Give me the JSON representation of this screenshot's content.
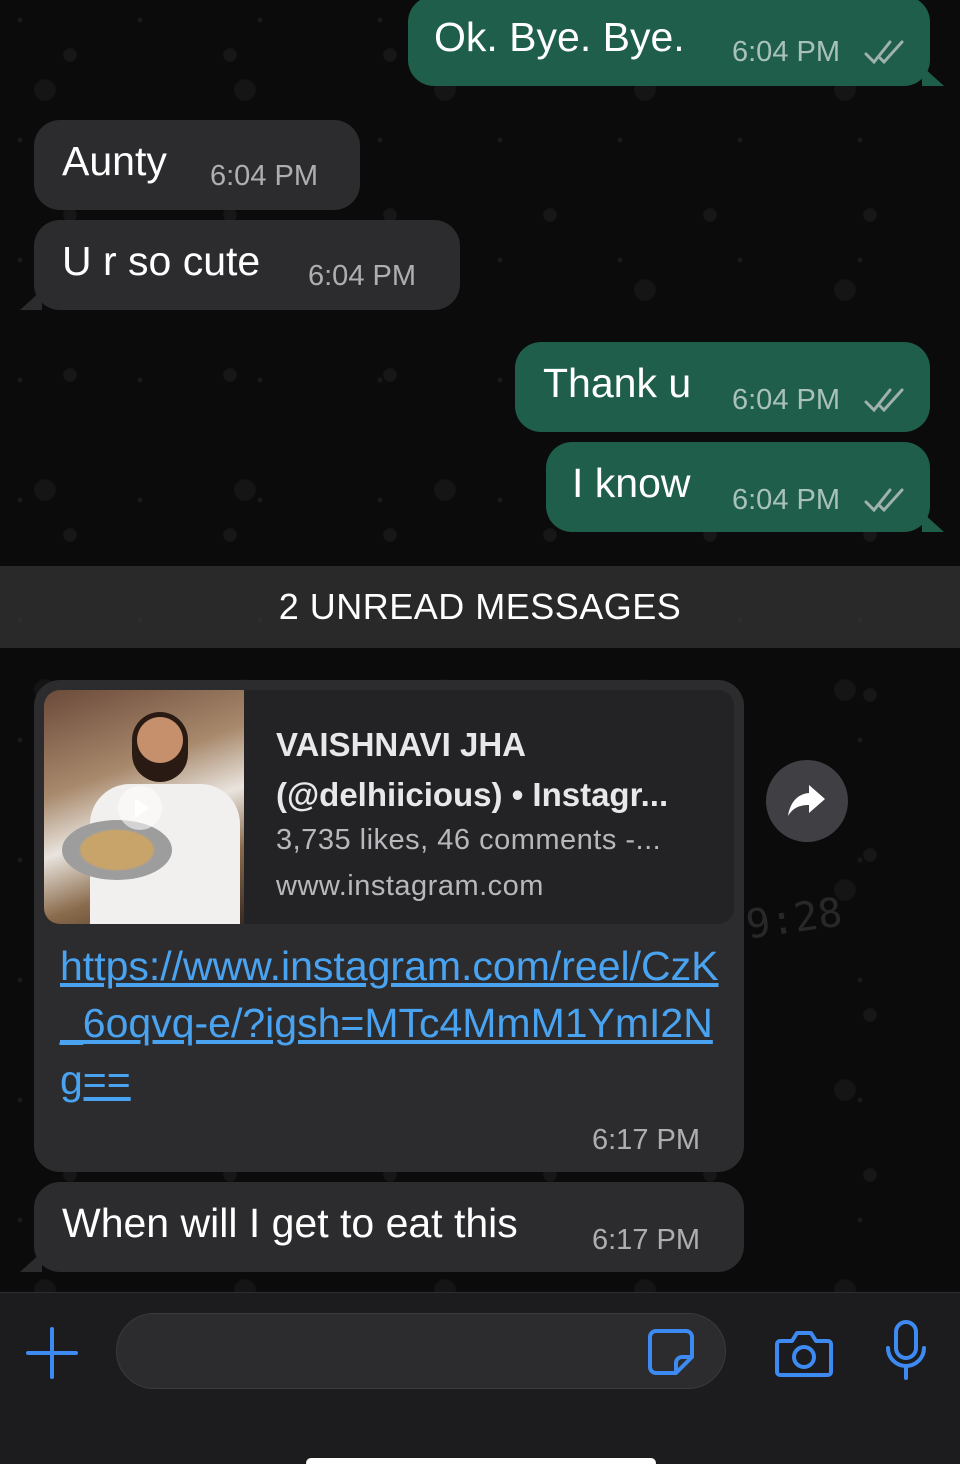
{
  "colors": {
    "outgoing_bubble": "#1e5e4a",
    "incoming_bubble": "#2c2c2e",
    "link": "#4aa3f0",
    "accent_icon": "#3d8bf2",
    "background": "#0b0b0b"
  },
  "messages": [
    {
      "id": "m1",
      "direction": "outgoing",
      "text": "Ok. Bye. Bye.",
      "time": "6:04 PM",
      "status_icon": "double-check-icon"
    },
    {
      "id": "m2",
      "direction": "incoming",
      "text": "Aunty",
      "time": "6:04 PM"
    },
    {
      "id": "m3",
      "direction": "incoming",
      "text": "U r so cute",
      "time": "6:04 PM"
    },
    {
      "id": "m4",
      "direction": "outgoing",
      "text": "Thank u",
      "time": "6:04 PM",
      "status_icon": "double-check-icon"
    },
    {
      "id": "m5",
      "direction": "outgoing",
      "text": "I know",
      "time": "6:04 PM",
      "status_icon": "double-check-icon"
    }
  ],
  "unread_divider": "2 UNREAD MESSAGES",
  "link_message": {
    "preview": {
      "title_line1": "VAISHNAVI JHA",
      "title_line2": "(@delhiicious) • Instagr...",
      "description": "3,735 likes, 46 comments -...",
      "domain": "www.instagram.com",
      "thumbnail_icon": "video-thumbnail-icon"
    },
    "url_text": "https://www.instagram.com/reel/CzK_6oqvq-e/?igsh=MTc4MmM1YmI2Ng==",
    "time": "6:17 PM"
  },
  "last_message": {
    "text": "When will I get to eat this",
    "time": "6:17 PM"
  },
  "input_bar": {
    "placeholder": "",
    "value": "",
    "icons": [
      "plus-icon",
      "sticker-icon",
      "camera-icon",
      "microphone-icon"
    ]
  },
  "wallpaper_text": "9:28"
}
